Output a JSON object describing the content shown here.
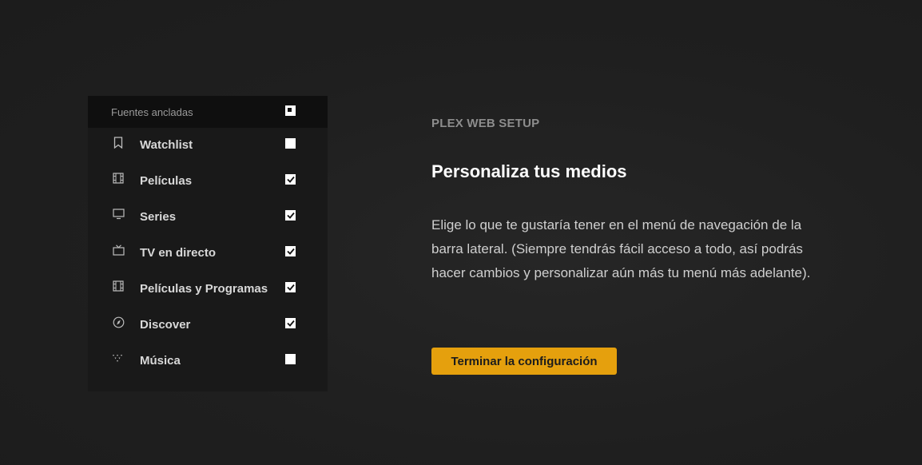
{
  "sidebar_panel": {
    "header_title": "Fuentes ancladas",
    "items": [
      {
        "label": "Watchlist",
        "icon": "bookmark-icon",
        "checked": false
      },
      {
        "label": "Películas",
        "icon": "film-icon",
        "checked": true
      },
      {
        "label": "Series",
        "icon": "tv-icon",
        "checked": true
      },
      {
        "label": "TV en directo",
        "icon": "live-tv-icon",
        "checked": true
      },
      {
        "label": "Películas y Programas",
        "icon": "film-icon",
        "checked": true
      },
      {
        "label": "Discover",
        "icon": "compass-icon",
        "checked": true
      },
      {
        "label": "Música",
        "icon": "music-icon",
        "checked": false
      }
    ]
  },
  "setup": {
    "eyebrow": "PLEX WEB SETUP",
    "title": "Personaliza tus medios",
    "description": "Elige lo que te gustaría tener en el menú de navegación de la barra lateral. (Siempre tendrás fácil acceso a todo, así podrás hacer cambios y personalizar aún más tu menú más adelante).",
    "button_label": "Terminar la configuración"
  },
  "colors": {
    "background": "#1f1f1f",
    "accent": "#e5a00d"
  }
}
